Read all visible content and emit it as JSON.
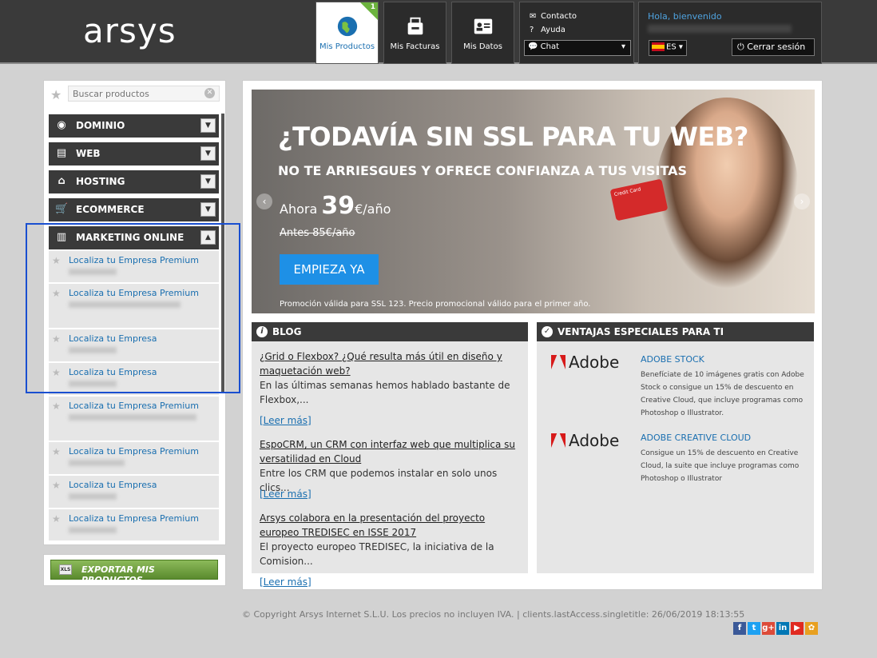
{
  "header": {
    "logo": "arsys",
    "tabs": [
      {
        "label": "Mis Productos",
        "badge": "1",
        "icon": "globe-icon"
      },
      {
        "label": "Mis Facturas",
        "icon": "basket-icon"
      },
      {
        "label": "Mis Datos",
        "icon": "id-card-icon"
      }
    ],
    "contact": {
      "label": "Contacto",
      "icon": "envelope-icon"
    },
    "help": {
      "label": "Ayuda",
      "icon": "question-icon"
    },
    "chat": {
      "label": "Chat",
      "icon": "chat-bubble-icon"
    },
    "greeting": "Hola, bienvenido",
    "language": "ES",
    "logout": "Cerrar sesión"
  },
  "sidebar": {
    "search_placeholder": "Buscar productos",
    "categories": [
      {
        "label": "DOMINIO",
        "icon": "globe-icon"
      },
      {
        "label": "WEB",
        "icon": "document-icon"
      },
      {
        "label": "HOSTING",
        "icon": "home-icon"
      },
      {
        "label": "ECOMMERCE",
        "icon": "cart-icon"
      },
      {
        "label": "MARKETING ONLINE",
        "icon": "bar-chart-icon"
      }
    ],
    "products": [
      "Localiza tu Empresa Premium",
      "Localiza tu Empresa Premium",
      "Localiza tu Empresa",
      "Localiza tu Empresa",
      "Localiza tu Empresa Premium",
      "Localiza tu Empresa Premium",
      "Localiza tu Empresa",
      "Localiza tu Empresa Premium"
    ],
    "export_label": "EXPORTAR MIS PRODUCTOS"
  },
  "banner": {
    "headline": "¿TODAVÍA SIN SSL PARA TU WEB?",
    "subheadline": "NO TE ARRIESGUES Y OFRECE CONFIANZA A TUS VISITAS",
    "price_prefix": "Ahora",
    "price_value": "39",
    "price_suffix": "€/año",
    "old_price": "Antes 85€/año",
    "cta": "EMPIEZA YA",
    "note": "Promoción válida para SSL 123. Precio promocional válido para el primer año.",
    "card_text": "Credit Card"
  },
  "blog": {
    "title": "BLOG",
    "posts": [
      {
        "title": "¿Grid o Flexbox? ¿Qué resulta más útil en diseño y maquetación web?",
        "desc": "En las últimas semanas hemos hablado bastante de Flexbox,..."
      },
      {
        "title": "EspoCRM, un CRM con interfaz web que multiplica su versatilidad en Cloud",
        "desc": "Entre los CRM que podemos instalar en solo unos clics..."
      },
      {
        "title": "Arsys colabora en la presentación del proyecto europeo TREDISEC en ISSE 2017",
        "desc": "El proyecto europeo TREDISEC,  la iniciativa de la Comision..."
      }
    ],
    "read_more": "[Leer más]"
  },
  "offers": {
    "title": "VENTAJAS ESPECIALES PARA TI",
    "items": [
      {
        "brand": "Adobe",
        "title": "ADOBE STOCK",
        "desc": "Benefíciate de 10 imágenes gratis con Adobe Stock o consigue un 15% de descuento en Creative Cloud, que incluye programas como Photoshop o Illustrator."
      },
      {
        "brand": "Adobe",
        "title": "ADOBE CREATIVE CLOUD",
        "desc": "Consigue un 15% de descuento en Creative Cloud, la suite que incluye programas como Photoshop o Illustrator"
      }
    ]
  },
  "footer": {
    "text": "© Copyright Arsys Internet S.L.U. Los precios no incluyen IVA. | clients.lastAccess.singletitle: 26/06/2019 18:13:55",
    "social": [
      {
        "icon": "facebook-icon",
        "glyph": "f",
        "color": "#3b5998"
      },
      {
        "icon": "twitter-icon",
        "glyph": "t",
        "color": "#1da1f2"
      },
      {
        "icon": "google-plus-icon",
        "glyph": "g+",
        "color": "#dd4b39"
      },
      {
        "icon": "linkedin-icon",
        "glyph": "in",
        "color": "#0077b5"
      },
      {
        "icon": "youtube-icon",
        "glyph": "▶",
        "color": "#e02a20"
      },
      {
        "icon": "tuenti-icon",
        "glyph": "✿",
        "color": "#e8a020"
      }
    ]
  }
}
